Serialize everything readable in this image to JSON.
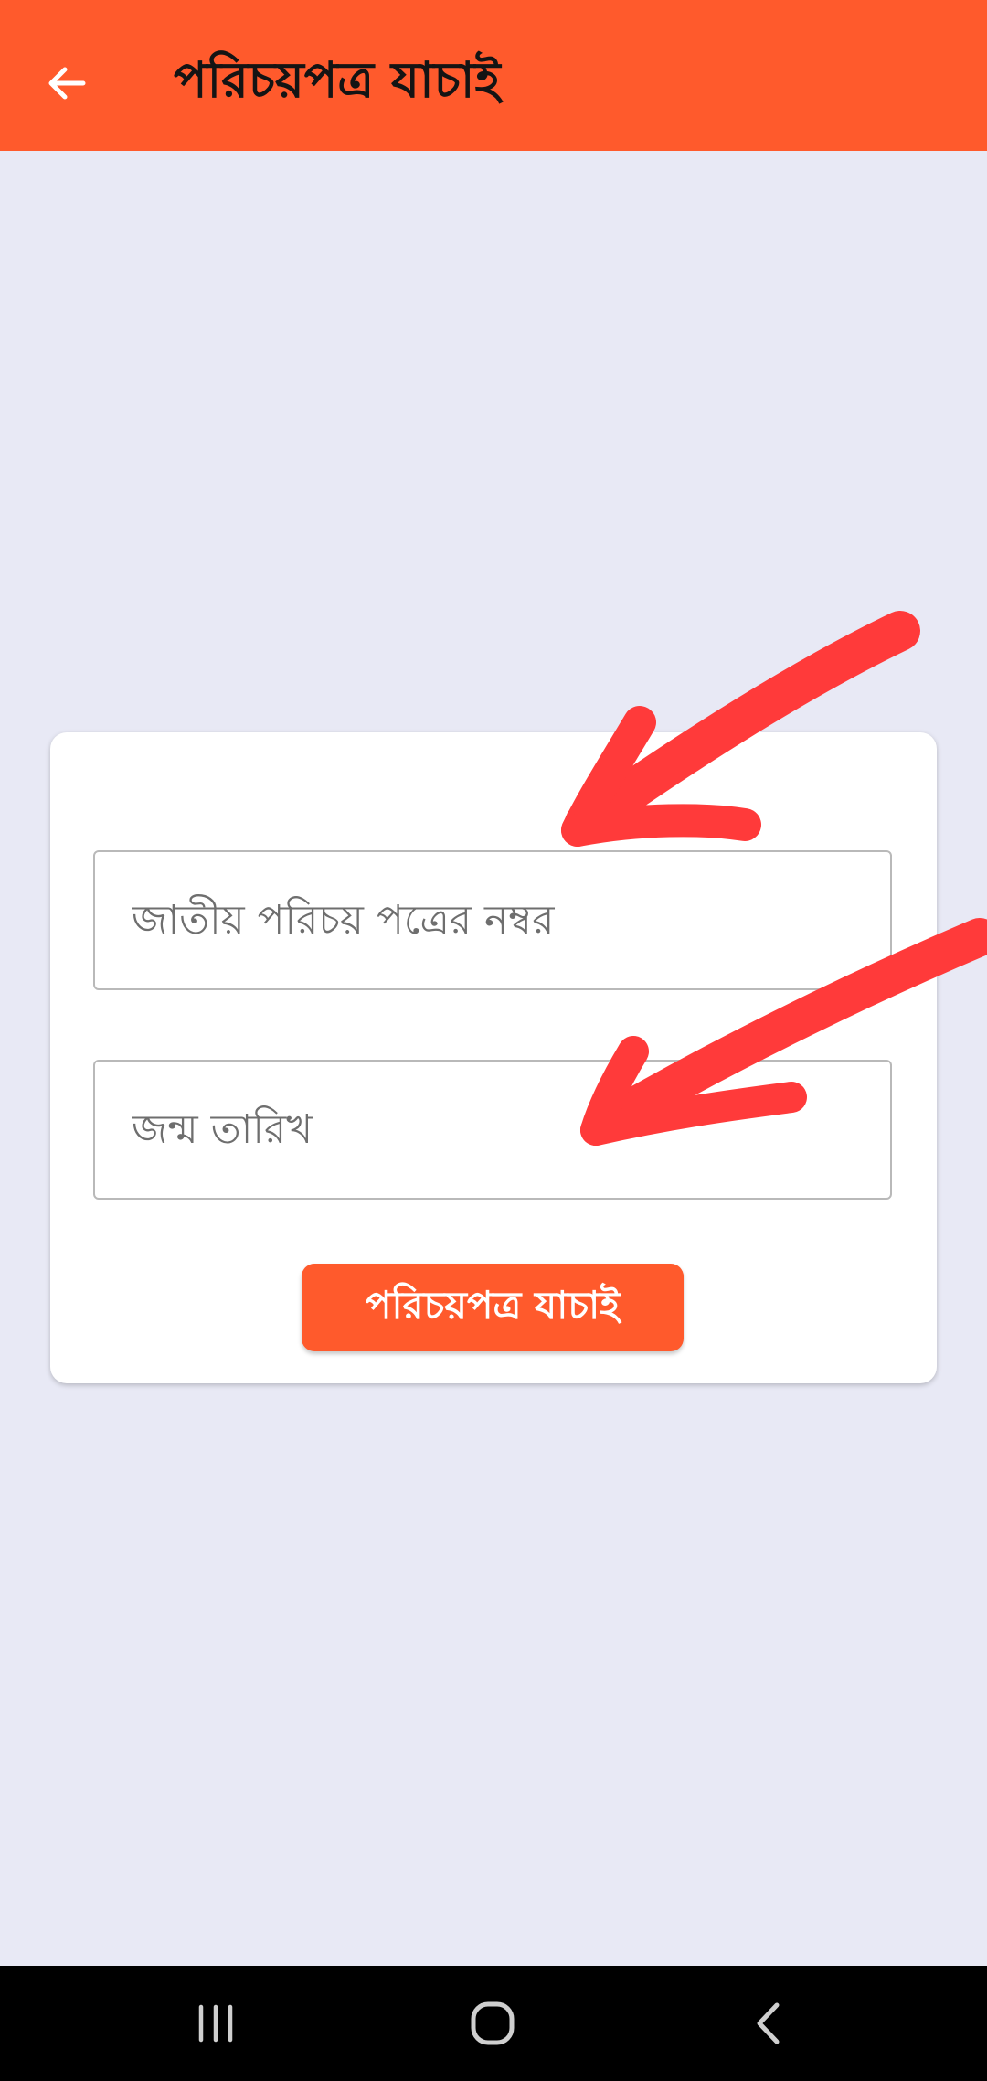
{
  "app_bar": {
    "title": "পরিচয়পত্র যাচাই",
    "back_icon": "arrow-left-icon",
    "color": "#ff5a2c"
  },
  "form": {
    "nid_field": {
      "placeholder": "জাতীয় পরিচয় পত্রের নম্বর",
      "value": ""
    },
    "dob_field": {
      "placeholder": "জন্ম তারিখ",
      "value": ""
    },
    "submit_label": "পরিচয়পত্র যাচাই"
  },
  "annotations": {
    "arrow_color": "#ff3a3a",
    "arrows": [
      "arrow-to-nid-field",
      "arrow-to-dob-field"
    ]
  },
  "system_nav": {
    "icons": [
      "recents-icon",
      "home-icon",
      "back-icon"
    ]
  },
  "colors": {
    "accent": "#ff5a2c",
    "background": "#e8e9f5",
    "card": "#ffffff",
    "nav_bar": "#000000"
  }
}
